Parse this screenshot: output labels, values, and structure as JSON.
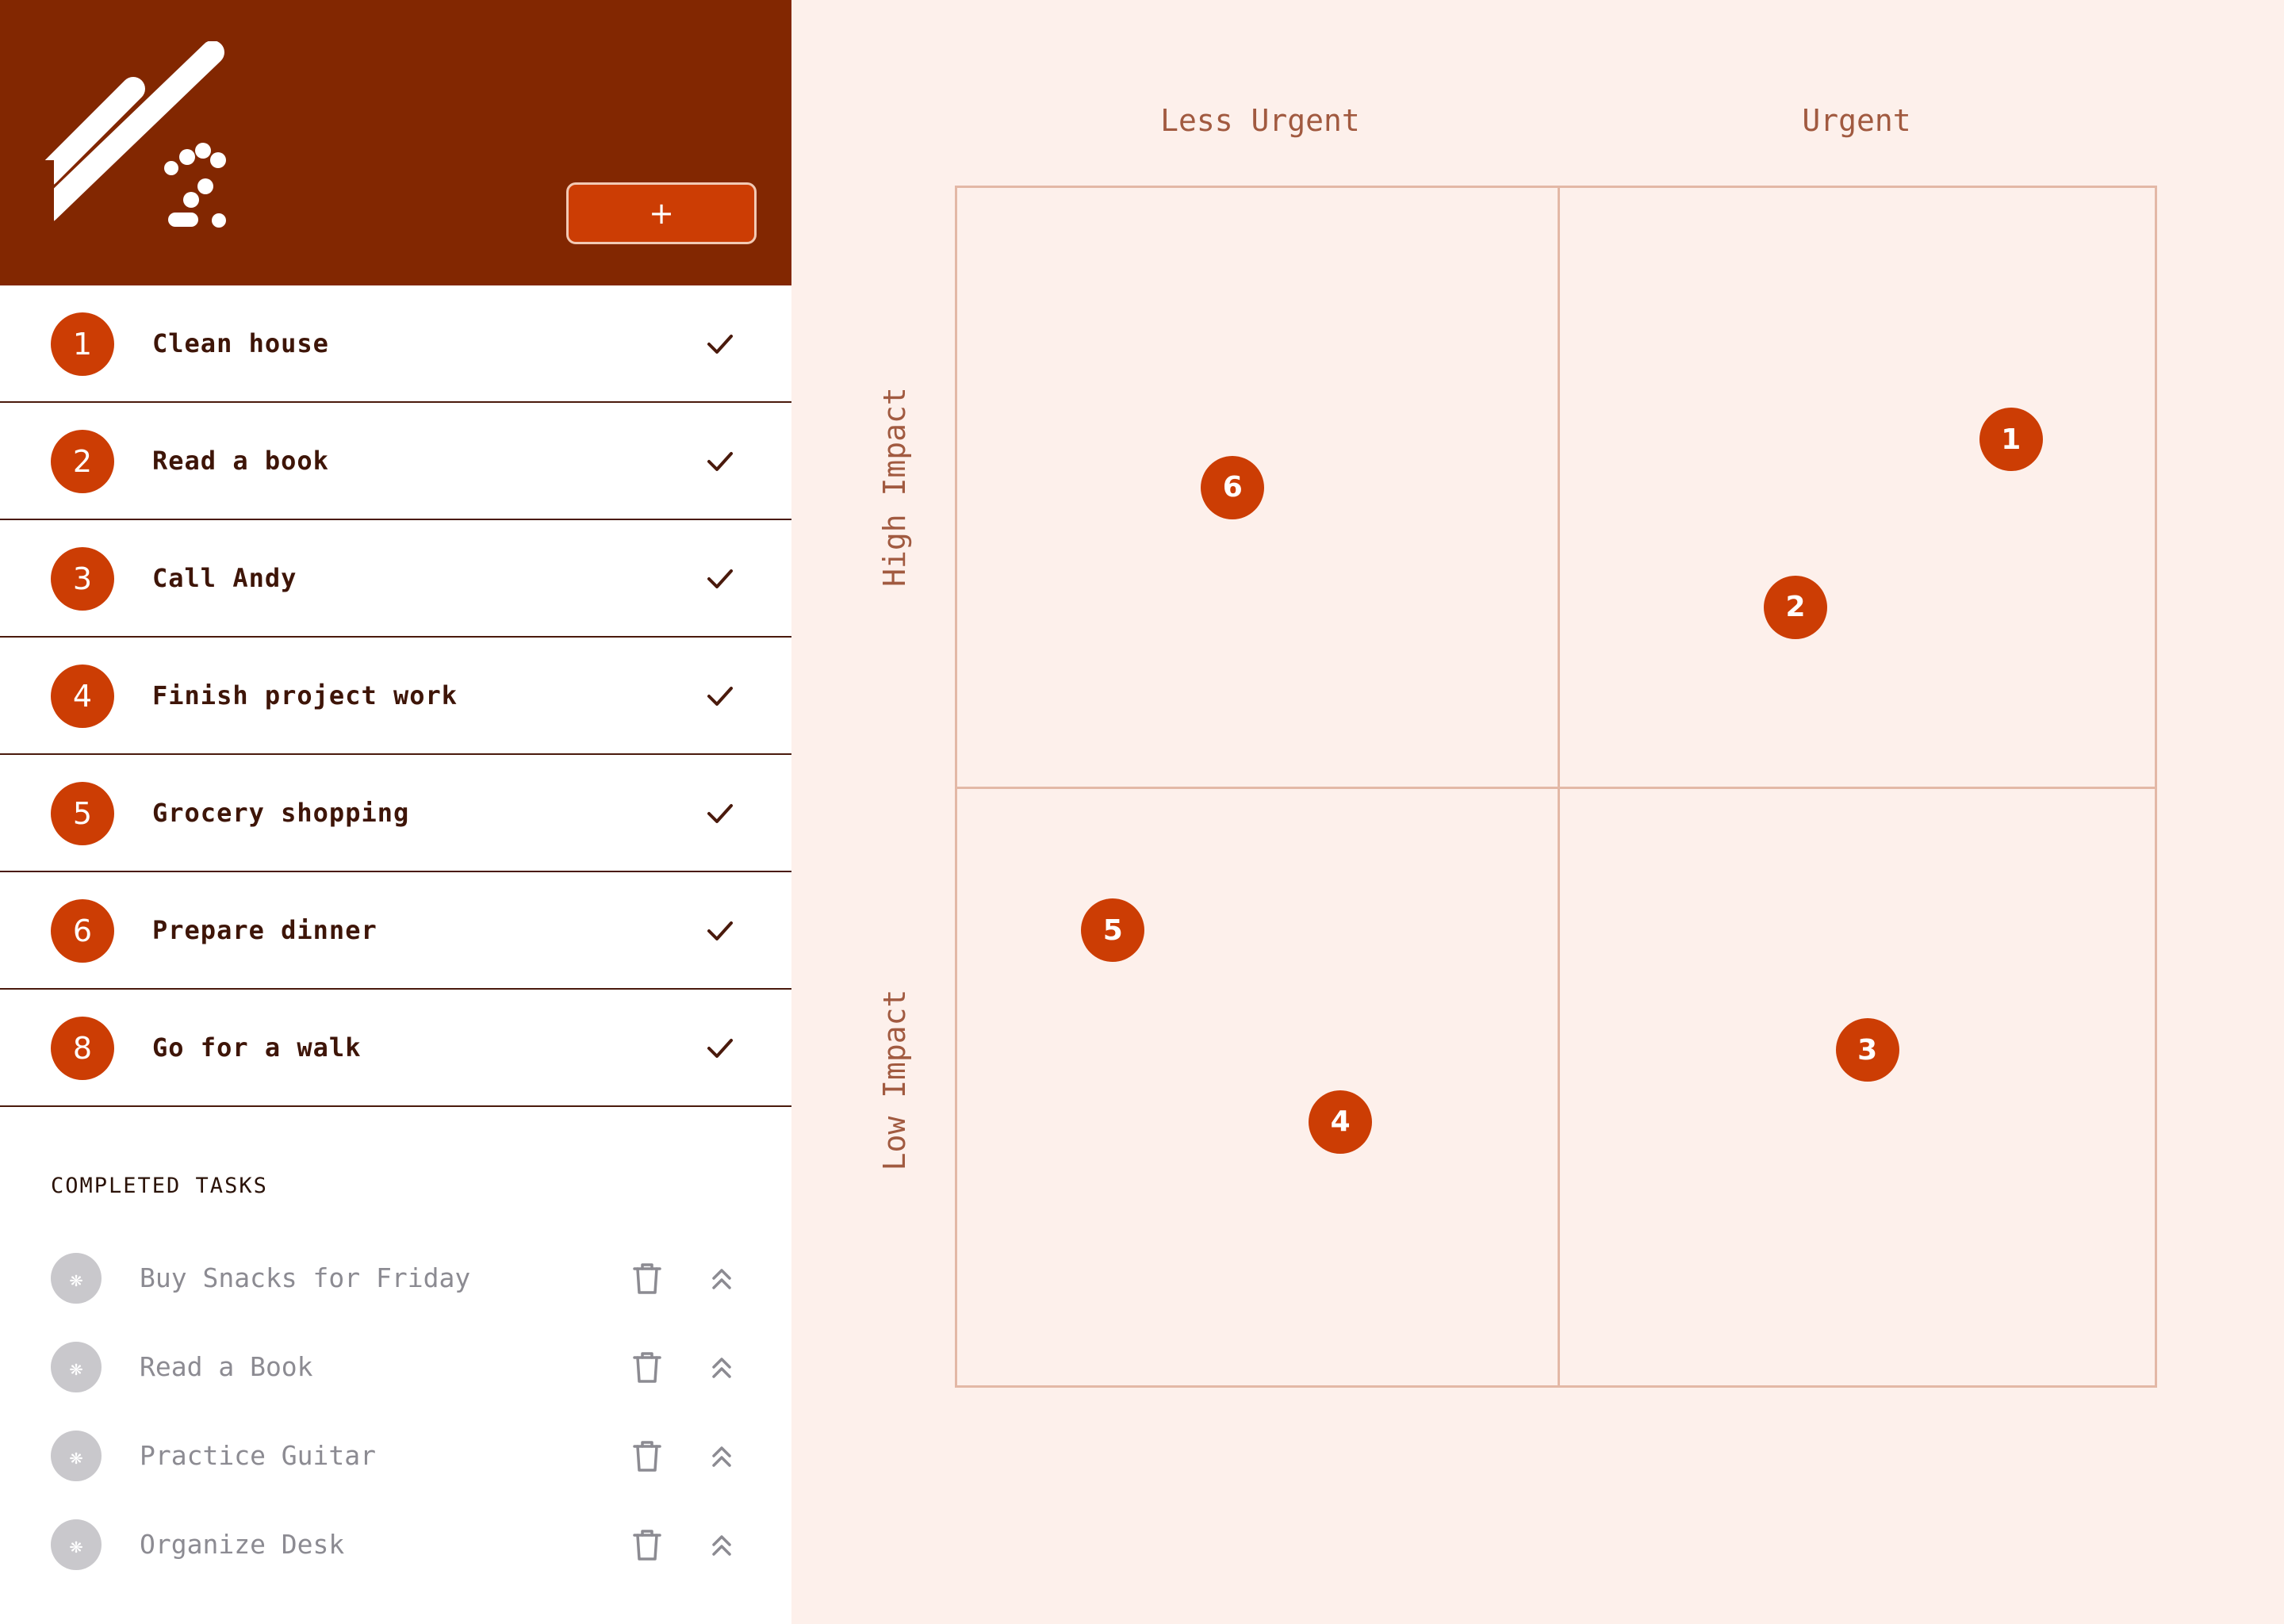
{
  "header": {
    "add_button_label": "+"
  },
  "tasks": [
    {
      "id": "1",
      "label": "Clean house"
    },
    {
      "id": "2",
      "label": "Read a book"
    },
    {
      "id": "3",
      "label": "Call Andy"
    },
    {
      "id": "4",
      "label": "Finish project work"
    },
    {
      "id": "5",
      "label": "Grocery shopping"
    },
    {
      "id": "6",
      "label": "Prepare dinner"
    },
    {
      "id": "8",
      "label": "Go for a walk"
    }
  ],
  "completed": {
    "heading": "COMPLETED TASKS",
    "badge_glyph": "❋",
    "items": [
      {
        "label": "Buy Snacks for Friday"
      },
      {
        "label": "Read a Book"
      },
      {
        "label": "Practice Guitar"
      },
      {
        "label": "Organize Desk"
      }
    ]
  },
  "matrix": {
    "columns": [
      "Less Urgent",
      "Urgent"
    ],
    "rows": [
      "High Impact",
      "Low Impact"
    ],
    "points": [
      {
        "id": "1",
        "urgency": 0.88,
        "impact": 0.79
      },
      {
        "id": "2",
        "urgency": 0.7,
        "impact": 0.65
      },
      {
        "id": "6",
        "urgency": 0.23,
        "impact": 0.75
      },
      {
        "id": "5",
        "urgency": 0.13,
        "impact": 0.38
      },
      {
        "id": "4",
        "urgency": 0.32,
        "impact": 0.22
      },
      {
        "id": "3",
        "urgency": 0.76,
        "impact": 0.28
      }
    ]
  },
  "colors": {
    "header_bg": "#822701",
    "accent": "#cc3d04",
    "canvas_bg": "#fdf0eb",
    "grid_line": "#e3b8a6",
    "label_text": "#a15a40"
  },
  "icons": {
    "logo": "striped-slash-logo",
    "check": "check-icon",
    "trash": "trash-icon",
    "restore": "chevrons-up-icon"
  }
}
